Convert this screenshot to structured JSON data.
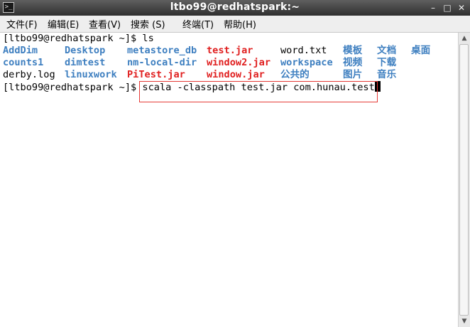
{
  "window": {
    "title": "ltbo99@redhatspark:~",
    "icon_glyph": ">_",
    "minimize_glyph": "–",
    "maximize_glyph": "□",
    "close_glyph": "✕"
  },
  "menu": [
    {
      "label": "文件(F)"
    },
    {
      "label": "编辑(E)"
    },
    {
      "label": "查看(V)"
    },
    {
      "label": "搜索 (S)"
    },
    {
      "label": "终端(T)"
    },
    {
      "label": "帮助(H)"
    }
  ],
  "terminal": {
    "line1": "[ltbo99@redhatspark ~]$ ls",
    "listing": {
      "row1": [
        "AddDim",
        "Desktop",
        "metastore_db",
        "test.jar",
        "word.txt",
        "模板",
        "文档",
        "桌面"
      ],
      "row2": [
        "counts1",
        "dimtest",
        "nm-local-dir",
        "window2.jar",
        "workspace",
        "视频",
        "下载"
      ],
      "row3": [
        "derby.log",
        "linuxwork",
        "PiTest.jar",
        "window.jar",
        "公共的",
        "图片",
        "音乐"
      ]
    },
    "prompt": "[ltbo99@redhatspark ~]$ ",
    "command": "scala -classpath test.jar com.hunau.test"
  },
  "colors": {
    "directory": "#3e7fc0",
    "jar": "#e02020",
    "highlight_box": "#e53935"
  }
}
